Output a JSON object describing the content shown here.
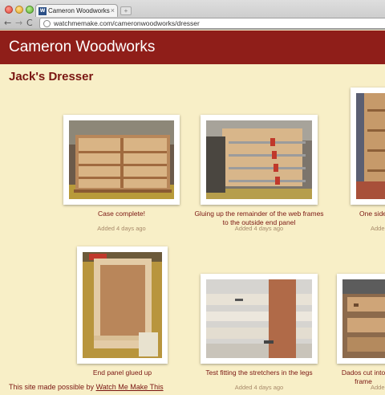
{
  "browser": {
    "tab_title": "Cameron Woodworks Jack's",
    "tab_favicon": "W",
    "tab_close": "×",
    "new_tab": "+",
    "back_icon": "←",
    "forward_icon": "→",
    "reload_icon": "C",
    "url": "watchmemake.com/cameronwoodworks/dresser"
  },
  "site": {
    "title": "Cameron Woodworks"
  },
  "page": {
    "heading": "Jack's Dresser"
  },
  "photos": [
    {
      "caption": "Case complete!",
      "meta": "Added 4 days ago"
    },
    {
      "caption": "Gluing up the remainder of the web frames to the outside end panel",
      "meta": "Added 4 days ago"
    },
    {
      "caption": "One side",
      "meta": "Adde"
    },
    {
      "caption": "End panel glued up",
      "meta": "Added 4 days ago"
    },
    {
      "caption": "Test fitting the stretchers in the legs",
      "meta": "Added 4 days ago"
    },
    {
      "caption": "Dados cut into frame",
      "meta": "Adde"
    }
  ],
  "footer": {
    "prefix": "This site made possible by ",
    "link": "Watch Me Make This"
  },
  "colors": {
    "header_bg": "#8f1e19",
    "page_bg": "#f8efc7",
    "text_accent": "#7a1612",
    "meta_text": "#a88a6a"
  }
}
